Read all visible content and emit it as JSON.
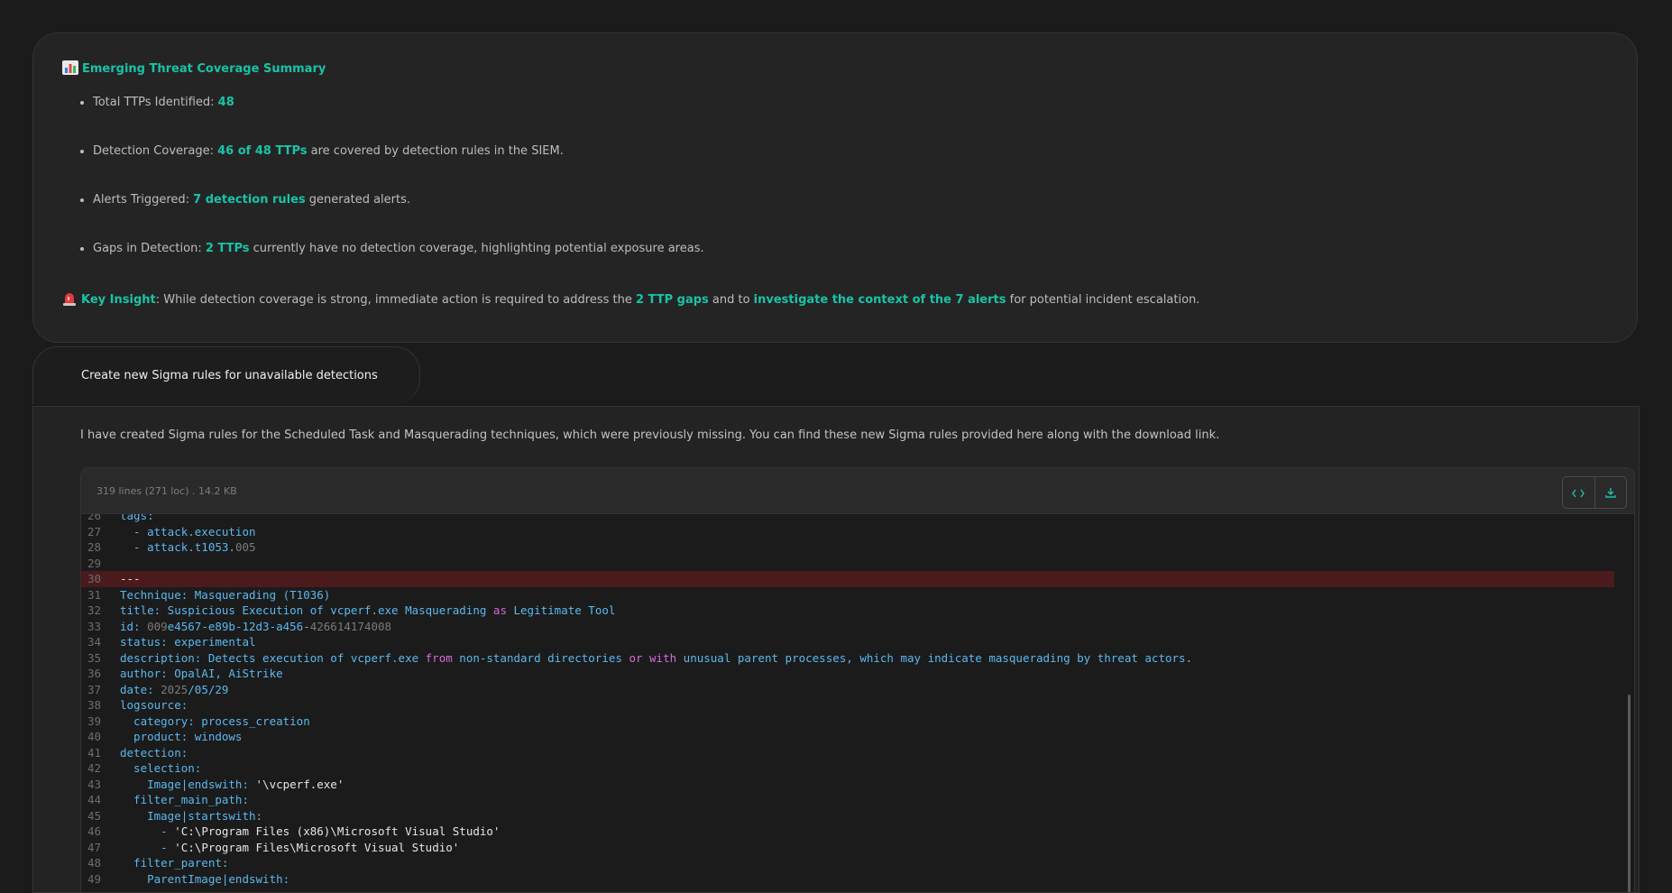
{
  "summary": {
    "title": "Emerging Threat Coverage Summary",
    "items": [
      {
        "prefix": "Total TTPs Identified: ",
        "highlight": "48",
        "suffix": ""
      },
      {
        "prefix": "Detection Coverage: ",
        "highlight": "46 of 48 TTPs",
        "suffix": " are covered by detection rules in the SIEM."
      },
      {
        "prefix": "Alerts Triggered: ",
        "highlight": "7 detection rules",
        "suffix": " generated alerts."
      },
      {
        "prefix": "Gaps in Detection: ",
        "highlight": "2 TTPs",
        "suffix": " currently have no detection coverage, highlighting potential exposure areas."
      }
    ],
    "insight": {
      "label": "Key Insight",
      "text1": ": While detection coverage is strong, immediate action is required to address the ",
      "hl1": "2 TTP gaps",
      "text2": " and to ",
      "hl2": "investigate the context of the 7 alerts",
      "text3": " for potential incident escalation."
    }
  },
  "prompt": "Create new Sigma rules for unavailable detections",
  "answer": {
    "text": "I have created Sigma rules for the Scheduled Task and Masquerading techniques, which were previously missing. You can find these new Sigma rules provided here along with the download link.",
    "code_meta": "319 lines (271 loc) . 14.2 KB",
    "view_code_icon": "code-icon",
    "download_icon": "download-icon",
    "code_lines": [
      {
        "n": "26",
        "t": "tags:",
        "err": false
      },
      {
        "n": "27",
        "t": "  - attack.execution",
        "err": false
      },
      {
        "n": "28",
        "t": "  - attack.t1053.005",
        "err": false
      },
      {
        "n": "29",
        "t": "",
        "err": false
      },
      {
        "n": "30",
        "t": "---",
        "err": true
      },
      {
        "n": "31",
        "t": "Technique: Masquerading (T1036)",
        "err": false
      },
      {
        "n": "32",
        "t": "title: Suspicious Execution of vcperf.exe Masquerading as Legitimate Tool",
        "err": false
      },
      {
        "n": "33",
        "t": "id: 009e4567-e89b-12d3-a456-426614174008",
        "err": false
      },
      {
        "n": "34",
        "t": "status: experimental",
        "err": false
      },
      {
        "n": "35",
        "t": "description: Detects execution of vcperf.exe from non-standard directories or with unusual parent processes, which may indicate masquerading by threat actors.",
        "err": false
      },
      {
        "n": "36",
        "t": "author: OpalAI, AiStrike",
        "err": false
      },
      {
        "n": "37",
        "t": "date: 2025/05/29",
        "err": false
      },
      {
        "n": "38",
        "t": "logsource:",
        "err": false
      },
      {
        "n": "39",
        "t": "  category: process_creation",
        "err": false
      },
      {
        "n": "40",
        "t": "  product: windows",
        "err": false
      },
      {
        "n": "41",
        "t": "detection:",
        "err": false
      },
      {
        "n": "42",
        "t": "  selection:",
        "err": false
      },
      {
        "n": "43",
        "t": "    Image|endswith: '\\vcperf.exe'",
        "err": false
      },
      {
        "n": "44",
        "t": "  filter_main_path:",
        "err": false
      },
      {
        "n": "45",
        "t": "    Image|startswith:",
        "err": false
      },
      {
        "n": "46",
        "t": "      - 'C:\\Program Files (x86)\\Microsoft Visual Studio'",
        "err": false
      },
      {
        "n": "47",
        "t": "      - 'C:\\Program Files\\Microsoft Visual Studio'",
        "err": false
      },
      {
        "n": "48",
        "t": "  filter_parent:",
        "err": false
      },
      {
        "n": "49",
        "t": "    ParentImage|endswith:",
        "err": false
      }
    ]
  },
  "colors": {
    "accent": "#19c3a6",
    "error_line": "#4a1a1d",
    "keyword": "#d36dd8",
    "code_text": "#5bb8ef"
  }
}
